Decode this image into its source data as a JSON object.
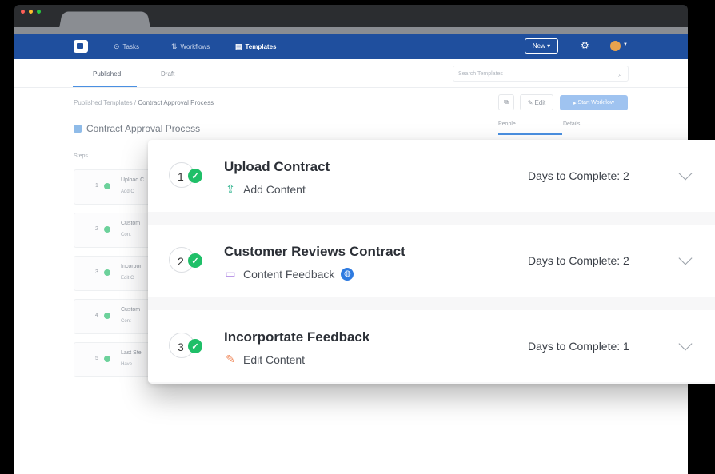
{
  "app": {
    "nav": {
      "items": [
        {
          "label": "Tasks",
          "glyph": "⊙",
          "active": false
        },
        {
          "label": "Workflows",
          "glyph": "⇅",
          "active": false
        },
        {
          "label": "Templates",
          "glyph": "▤",
          "active": true
        }
      ],
      "new_button": "New ▾"
    },
    "subtabs": [
      "Published",
      "Draft"
    ],
    "search_placeholder": "Search Templates",
    "breadcrumb": {
      "parent": "Published Templates",
      "separator": " / ",
      "current": "Contract Approval Process"
    },
    "toolbar": {
      "edit_label": "Edit",
      "start_label": "Start Workflow"
    },
    "page_title": "Contract Approval Process",
    "side_tabs": [
      "People",
      "Details"
    ],
    "steps_label": "Steps",
    "background_steps": [
      {
        "num": "1",
        "title": "Upload C",
        "sub": "Add C"
      },
      {
        "num": "2",
        "title": "Custom",
        "sub": "Cont"
      },
      {
        "num": "3",
        "title": "Incorpor",
        "sub": "Edit C"
      },
      {
        "num": "4",
        "title": "Custom",
        "sub": "Cont"
      },
      {
        "num": "5",
        "title": "Last Ste",
        "sub": "Have"
      }
    ]
  },
  "card": {
    "steps": [
      {
        "num": "1",
        "title": "Upload Contract",
        "action": "Add Content",
        "action_icon": "upload-icon",
        "days": "Days to Complete:  2"
      },
      {
        "num": "2",
        "title": "Customer Reviews Contract",
        "action": "Content Feedback",
        "action_icon": "comment-icon",
        "days": "Days to Complete:  2"
      },
      {
        "num": "3",
        "title": "Incorportate Feedback",
        "action": "Edit Content",
        "action_icon": "pencil-icon",
        "days": "Days to Complete:  1"
      }
    ]
  },
  "colors": {
    "navbar": "#1f4f9e",
    "accent": "#4a90e2",
    "success": "#1fbf68"
  }
}
